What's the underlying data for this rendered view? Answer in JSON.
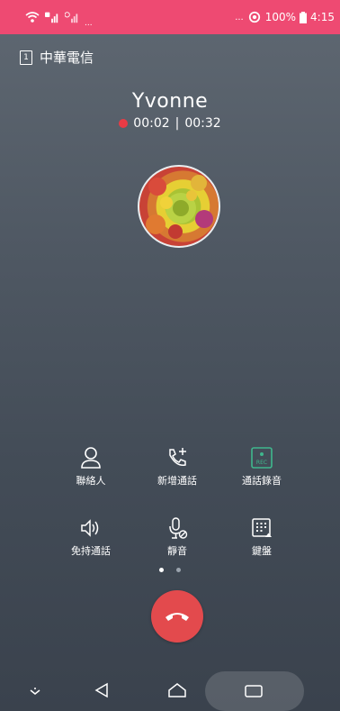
{
  "status_bar": {
    "left_dots": "...",
    "right_dots": "...",
    "battery": "100%",
    "time": "4:15"
  },
  "carrier": {
    "sim_slot": "1",
    "name": "中華電信"
  },
  "call": {
    "contact_name": "Yvonne",
    "elapsed": "00:02",
    "separator": "|",
    "record_time": "00:32"
  },
  "controls": {
    "contacts": "聯絡人",
    "add_call": "新增通話",
    "record": "通話錄音",
    "speaker": "免持通話",
    "mute": "靜音",
    "keypad": "鍵盤",
    "rec_badge": "REC"
  },
  "colors": {
    "status_bar": "#ee4a72",
    "end_call": "#e34a4d",
    "record_dot": "#ea3b45",
    "record_icon": "#3fb78d"
  }
}
